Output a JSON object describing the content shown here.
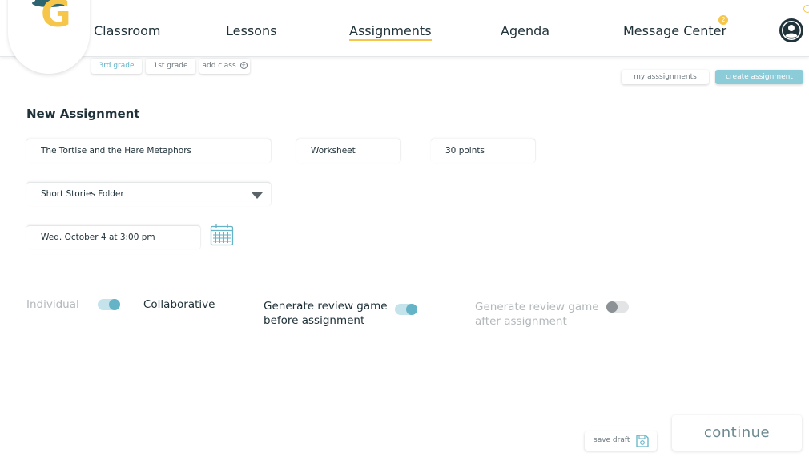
{
  "nav": {
    "items": [
      {
        "label": "Classroom"
      },
      {
        "label": "Lessons"
      },
      {
        "label": "Assignments"
      },
      {
        "label": "Agenda"
      },
      {
        "label": "Message Center"
      }
    ],
    "active": "Assignments",
    "message_badge": "2",
    "logo_letter": "G"
  },
  "classes": {
    "chips": [
      {
        "label": "3rd grade",
        "selected": true
      },
      {
        "label": "1st grade",
        "selected": false
      },
      {
        "label": "add class",
        "selected": false
      }
    ],
    "add_icon": "plus-circle-icon"
  },
  "header_buttons": {
    "my_assignments": "my asssignments",
    "create_assignment": "create assignment"
  },
  "form": {
    "title": "New Assignment",
    "assignment_name": "The Tortise and the Hare Metaphors",
    "type": "Worksheet",
    "points": "30 points",
    "folder": "Short Stories Folder",
    "due_date": "Wed. October 4 at 3:00 pm",
    "calendar_icon": "calendar-icon"
  },
  "options": {
    "individual": "Individual",
    "collaborative": "Collaborative",
    "mode_toggle_on": true,
    "review_before_line1": "Generate review game",
    "review_before_line2": "before assignment",
    "review_before_on": true,
    "review_after_line1": "Generate review game",
    "review_after_line2": "after assignment",
    "review_after_on": false
  },
  "footer": {
    "save_draft": "save draft",
    "save_icon": "floppy-disk-icon",
    "continue": "continue"
  },
  "colors": {
    "accent_yellow": "#f5c64a",
    "accent_teal": "#64b3c7",
    "dark_text": "#20323a",
    "muted_text": "#b3b8bb"
  }
}
